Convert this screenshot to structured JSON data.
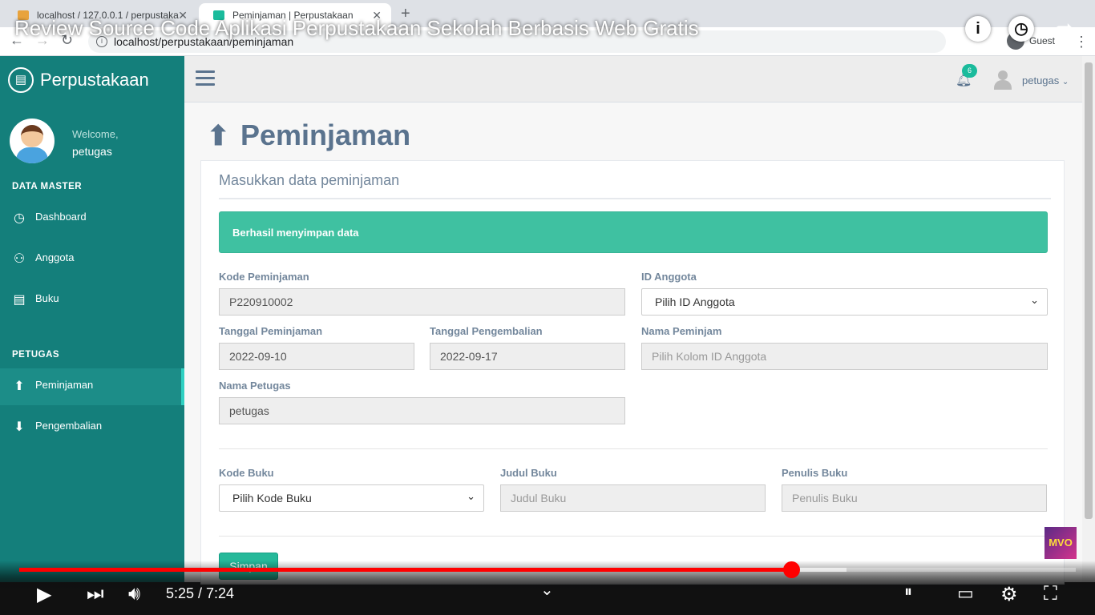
{
  "browser": {
    "tabs": [
      {
        "title": "localhost / 127.0.0.1 / perpustaka"
      },
      {
        "title": "Peminjaman | Perpustakaan"
      }
    ],
    "url": "localhost/perpustakaan/peminjaman",
    "profile": "Guest"
  },
  "video": {
    "title": "Review Source Code Aplikasi Perpustakaan Sekolah Berbasis Web Gratis",
    "time": "5:25 / 7:24",
    "progress": 0.731,
    "buffered": 0.783,
    "channel_logo": "MVO"
  },
  "sidebar": {
    "brand": "Perpustakaan",
    "welcome": "Welcome,",
    "user": "petugas",
    "sections": [
      {
        "title": "DATA MASTER",
        "items": [
          {
            "label": "Dashboard",
            "icon": "dashboard-icon"
          },
          {
            "label": "Anggota",
            "icon": "users-icon"
          },
          {
            "label": "Buku",
            "icon": "book-icon"
          }
        ]
      },
      {
        "title": "PETUGAS",
        "items": [
          {
            "label": "Peminjaman",
            "icon": "arrow-up-icon",
            "active": true
          },
          {
            "label": "Pengembalian",
            "icon": "arrow-down-icon"
          }
        ]
      }
    ]
  },
  "topnav": {
    "notification_count": "6",
    "user": "petugas"
  },
  "page": {
    "heading": "Peminjaman",
    "panel_title": "Masukkan data peminjaman",
    "alert": "Berhasil menyimpan data",
    "fields": {
      "kode_peminjaman": {
        "label": "Kode Peminjaman",
        "value": "P220910002"
      },
      "id_anggota": {
        "label": "ID Anggota",
        "value": "Pilih ID Anggota"
      },
      "tanggal_peminjaman": {
        "label": "Tanggal Peminjaman",
        "value": "2022-09-10"
      },
      "tanggal_pengembalian": {
        "label": "Tanggal Pengembalian",
        "value": "2022-09-17"
      },
      "nama_peminjam": {
        "label": "Nama Peminjam",
        "placeholder": "Pilih Kolom ID Anggota"
      },
      "nama_petugas": {
        "label": "Nama Petugas",
        "value": "petugas"
      },
      "kode_buku": {
        "label": "Kode Buku",
        "value": "Pilih Kode Buku"
      },
      "judul_buku": {
        "label": "Judul Buku",
        "placeholder": "Judul Buku"
      },
      "penulis_buku": {
        "label": "Penulis Buku",
        "placeholder": "Penulis Buku"
      }
    },
    "submit_label": "Simpan"
  },
  "colors": {
    "sidebar": "#147f7b",
    "alert": "#3fc1a1",
    "button": "#26b99a",
    "progress": "#ff0000"
  }
}
